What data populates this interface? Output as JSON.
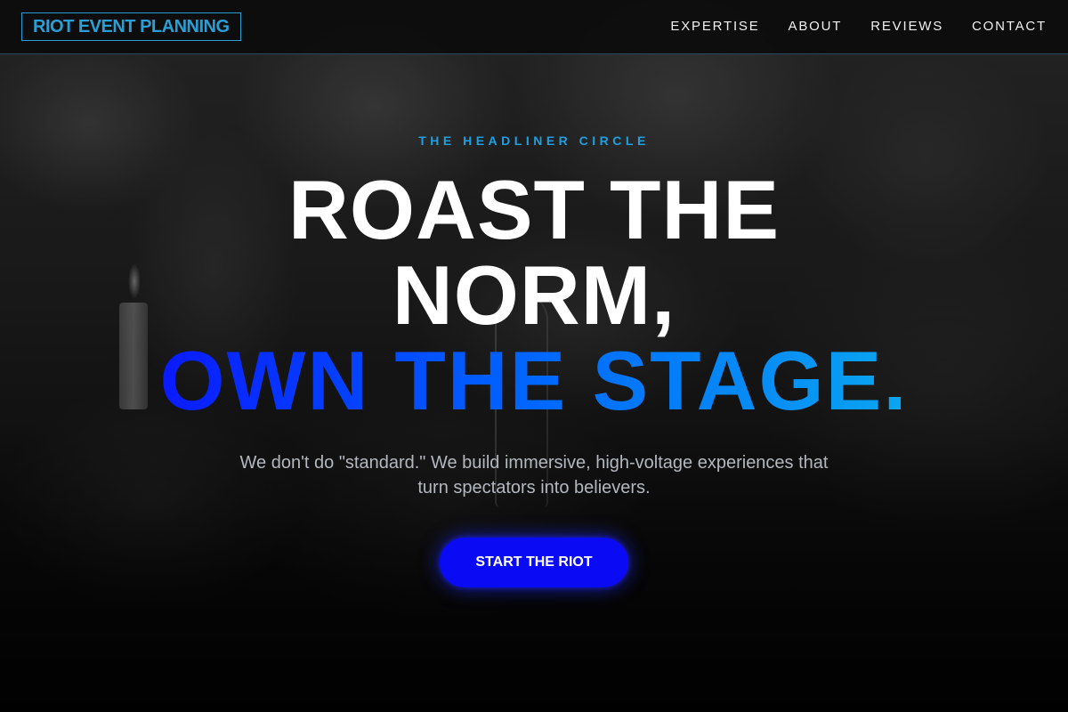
{
  "header": {
    "logo": "RIOT EVENT PLANNING",
    "nav": [
      {
        "label": "EXPERTISE"
      },
      {
        "label": "ABOUT"
      },
      {
        "label": "REVIEWS"
      },
      {
        "label": "CONTACT"
      }
    ]
  },
  "hero": {
    "eyebrow": "THE HEADLINER CIRCLE",
    "headline_line1": "ROAST THE",
    "headline_line2": "NORM,",
    "headline_accent": "OWN THE STAGE.",
    "subtext": "We don't do \"standard.\" We build immersive, high-voltage experiences that turn spectators into believers.",
    "cta_label": "START THE RIOT"
  },
  "colors": {
    "accent_cyan": "#1ea0e0",
    "accent_blue": "#0a0af5",
    "gradient_start": "#0a1aff",
    "gradient_end": "#0aa6f0"
  }
}
